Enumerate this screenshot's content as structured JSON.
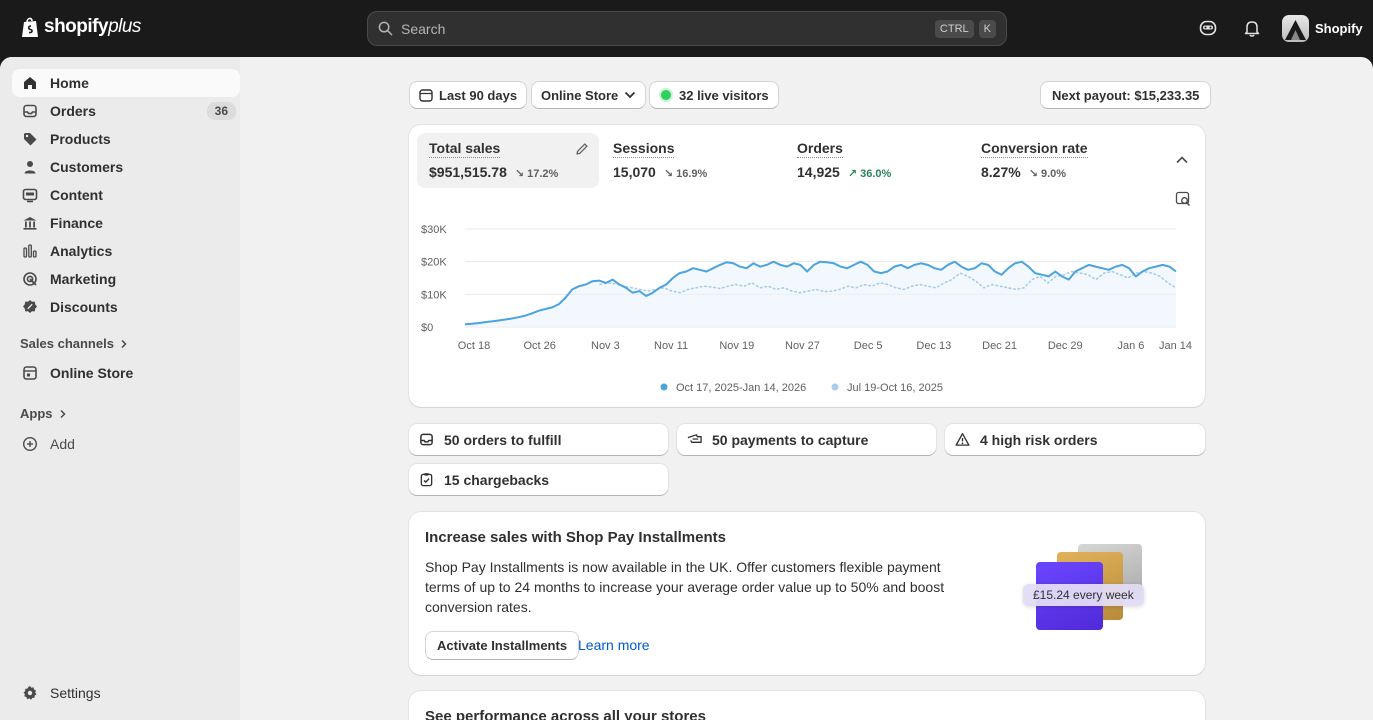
{
  "topbar": {
    "logo_text": "shopify",
    "logo_plus": "plus",
    "search": {
      "placeholder": "Search",
      "shortcut_1": "CTRL",
      "shortcut_2": "K"
    },
    "account_name": "Shopify"
  },
  "sidebar": {
    "items": [
      {
        "label": "Home",
        "icon": "home-icon",
        "active": true
      },
      {
        "label": "Orders",
        "icon": "inbox-icon",
        "badge": "36"
      },
      {
        "label": "Products",
        "icon": "tag-icon"
      },
      {
        "label": "Customers",
        "icon": "person-icon"
      },
      {
        "label": "Content",
        "icon": "content-icon"
      },
      {
        "label": "Finance",
        "icon": "bank-icon"
      },
      {
        "label": "Analytics",
        "icon": "bar-chart-icon"
      },
      {
        "label": "Marketing",
        "icon": "target-icon"
      },
      {
        "label": "Discounts",
        "icon": "discount-icon"
      }
    ],
    "sales_channels_label": "Sales channels",
    "online_store_label": "Online Store",
    "apps_label": "Apps",
    "add_label": "Add",
    "settings_label": "Settings"
  },
  "filters": {
    "date_range": "Last 90 days",
    "channel": "Online Store",
    "live_visitors": "32 live visitors",
    "next_payout": "Next payout: $15,233.35"
  },
  "metrics": [
    {
      "label": "Total sales",
      "value": "$951,515.78",
      "delta": "17.2%",
      "direction": "down"
    },
    {
      "label": "Sessions",
      "value": "15,070",
      "delta": "16.9%",
      "direction": "down"
    },
    {
      "label": "Orders",
      "value": "14,925",
      "delta": "36.0%",
      "direction": "up"
    },
    {
      "label": "Conversion rate",
      "value": "8.27%",
      "delta": "9.0%",
      "direction": "down"
    }
  ],
  "chart_data": {
    "type": "line",
    "x_labels": [
      "Oct 18",
      "Oct 26",
      "Nov 3",
      "Nov 11",
      "Nov 19",
      "Nov 27",
      "Dec 5",
      "Dec 13",
      "Dec 21",
      "Dec 29",
      "Jan 6",
      "Jan 14"
    ],
    "y_ticks": [
      "$0",
      "$10K",
      "$20K",
      "$30K"
    ],
    "ylim": [
      0,
      30000
    ],
    "legend_position": "bottom",
    "series": [
      {
        "name": "Oct 17, 2025-Jan 14, 2026",
        "color": "#4ba3e0",
        "style": "solid",
        "values": [
          800,
          1000,
          1200,
          1500,
          1700,
          2000,
          2300,
          2600,
          3000,
          3500,
          4200,
          5000,
          5500,
          6000,
          7000,
          9000,
          11500,
          12500,
          13000,
          14000,
          14200,
          13500,
          14500,
          13000,
          12000,
          10500,
          11000,
          9500,
          10500,
          12000,
          13000,
          15000,
          16500,
          17000,
          18000,
          17500,
          17000,
          18000,
          19000,
          19800,
          19500,
          18500,
          18000,
          19500,
          18500,
          19000,
          20000,
          19000,
          18500,
          19500,
          19000,
          17000,
          19000,
          20000,
          19800,
          19500,
          18500,
          18000,
          19000,
          20000,
          19000,
          17000,
          16500,
          17000,
          18500,
          19000,
          18000,
          19000,
          19500,
          19000,
          18000,
          17500,
          19000,
          20000,
          18500,
          17500,
          18000,
          19500,
          19000,
          17000,
          16000,
          18000,
          19500,
          20000,
          18500,
          16500,
          16000,
          15500,
          17000,
          15500,
          14500,
          17000,
          18000,
          19000,
          18500,
          18000,
          17500,
          18500,
          19000,
          18000,
          15500,
          17000,
          18000,
          18500,
          19000,
          18500,
          17000
        ]
      },
      {
        "name": "Jul 19-Oct 16, 2025",
        "color": "#a7ccec",
        "style": "dotted",
        "values": [
          13000,
          13500,
          13200,
          12500,
          12000,
          11500,
          11000,
          11500,
          12000,
          11000,
          10500,
          11500,
          12000,
          12500,
          12200,
          11800,
          12500,
          13000,
          12500,
          13500,
          12000,
          12500,
          11500,
          12000,
          11000,
          10500,
          11000,
          11500,
          10800,
          11000,
          11500,
          12500,
          12000,
          13000,
          12500,
          13500,
          13000,
          12000,
          11500,
          12500,
          13000,
          12500,
          12000,
          13500,
          14500,
          16500,
          15500,
          14000,
          12000,
          13000,
          12500,
          12000,
          11500,
          12000,
          14500,
          15500,
          13500,
          15500,
          16000,
          17000,
          16500,
          16000,
          14500,
          16500,
          17000,
          16000,
          15000,
          16500,
          17000,
          16500,
          15500,
          13500,
          12000
        ]
      }
    ]
  },
  "tasks": [
    {
      "label": "50 orders to fulfill",
      "icon": "inbox-icon"
    },
    {
      "label": "50 payments to capture",
      "icon": "cash-icon"
    },
    {
      "label": "4 high risk orders",
      "icon": "alert-triangle-icon"
    },
    {
      "label": "15 chargebacks",
      "icon": "clipboard-check-icon"
    }
  ],
  "promo": {
    "title": "Increase sales with Shop Pay Installments",
    "body": "Shop Pay Installments is now available in the UK. Offer customers flexible payment terms of up to 24 months to increase your average order value up to 50% and boost conversion rates.",
    "primary_button": "Activate Installments",
    "link": "Learn more",
    "illustration_price": "£15.24 every week"
  },
  "next_card_title": "See performance across all your stores",
  "colors": {
    "accent": "#4ba3e0",
    "live_dot": "#2fd05e",
    "up": "#29845a",
    "link": "#005bd3"
  }
}
